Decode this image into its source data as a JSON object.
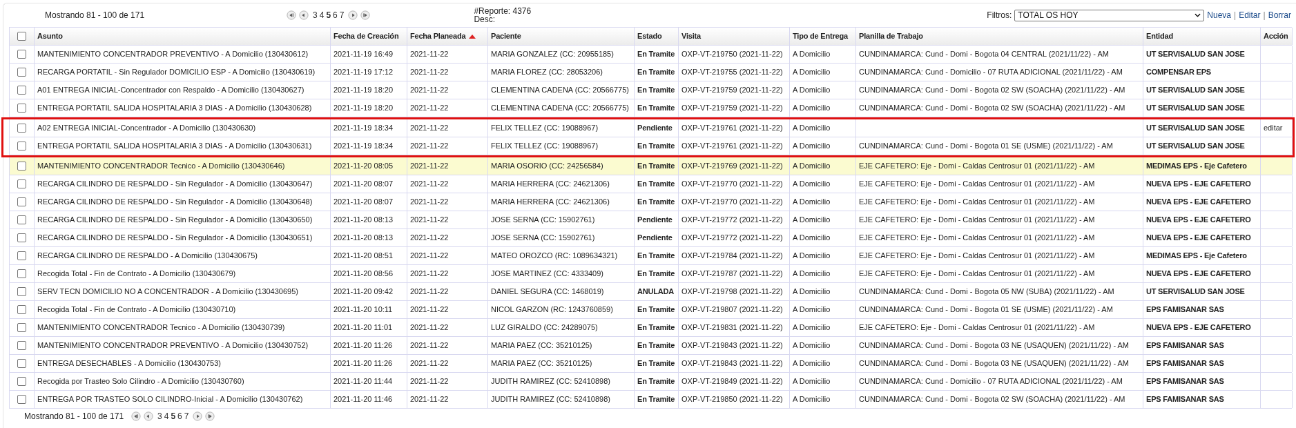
{
  "top_bar": {
    "showing": "Mostrando 81 - 100 de 171",
    "pager": {
      "pages": [
        {
          "label": "3",
          "selected": false
        },
        {
          "label": "4",
          "selected": false
        },
        {
          "label": "5",
          "selected": true
        },
        {
          "label": "6",
          "selected": false
        },
        {
          "label": "7",
          "selected": false
        }
      ]
    },
    "report": "#Reporte: 4376",
    "desc": "Desc:",
    "filter_label": "Filtros:",
    "filter_value": "TOTAL OS HOY",
    "links": [
      "Nueva",
      "Editar",
      "Borrar"
    ],
    "link_separator": "|"
  },
  "table": {
    "select_all": {
      "checked": false
    },
    "columns": [
      {
        "label": "Asunto",
        "sorted": false
      },
      {
        "label": "Fecha de Creación",
        "sorted": false
      },
      {
        "label": "Fecha Planeada",
        "sorted": true
      },
      {
        "label": "Paciente",
        "sorted": false
      },
      {
        "label": "Estado",
        "sorted": false
      },
      {
        "label": "Visita",
        "sorted": false
      },
      {
        "label": "Tipo de Entrega",
        "sorted": false
      },
      {
        "label": "Planilla de Trabajo",
        "sorted": false
      },
      {
        "label": "Entidad",
        "sorted": false
      },
      {
        "label": "Acción",
        "sorted": false
      }
    ],
    "rows": [
      {
        "checked": false,
        "highlighted": false,
        "outlined": false,
        "cells": [
          "MANTENIMIENTO CONCENTRADOR PREVENTIVO - A Domicilio (130430612)",
          "2021-11-19 16:49",
          "2021-11-22",
          "MARIA GONZALEZ (CC: 20955185)",
          "En Tramite",
          "OXP-VT-219750 (2021-11-22)",
          "A Domicilio",
          "CUNDINAMARCA: Cund - Domi - Bogota 04 CENTRAL (2021/11/22) - AM",
          "UT SERVISALUD SAN JOSE",
          ""
        ]
      },
      {
        "checked": false,
        "highlighted": false,
        "outlined": false,
        "cells": [
          "RECARGA PORTATIL - Sin Regulador DOMICILIO ESP - A Domicilio (130430619)",
          "2021-11-19 17:12",
          "2021-11-22",
          "MARIA FLOREZ (CC: 28053206)",
          "En Tramite",
          "OXP-VT-219755 (2021-11-22)",
          "A Domicilio",
          "CUNDINAMARCA: Cund - Domicilio - 07 RUTA ADICIONAL (2021/11/22) - AM",
          "COMPENSAR EPS",
          ""
        ]
      },
      {
        "checked": false,
        "highlighted": false,
        "outlined": false,
        "cells": [
          "A01 ENTREGA INICIAL-Concentrador con Respaldo - A Domicilio (130430627)",
          "2021-11-19 18:20",
          "2021-11-22",
          "CLEMENTINA CADENA (CC: 20566775)",
          "En Tramite",
          "OXP-VT-219759 (2021-11-22)",
          "A Domicilio",
          "CUNDINAMARCA: Cund - Domi - Bogota 02 SW (SOACHA) (2021/11/22) - AM",
          "UT SERVISALUD SAN JOSE",
          ""
        ]
      },
      {
        "checked": false,
        "highlighted": false,
        "outlined": false,
        "cells": [
          "ENTREGA PORTATIL SALIDA HOSPITALARIA 3 DIAS - A Domicilio (130430628)",
          "2021-11-19 18:20",
          "2021-11-22",
          "CLEMENTINA CADENA (CC: 20566775)",
          "En Tramite",
          "OXP-VT-219759 (2021-11-22)",
          "A Domicilio",
          "CUNDINAMARCA: Cund - Domi - Bogota 02 SW (SOACHA) (2021/11/22) - AM",
          "UT SERVISALUD SAN JOSE",
          ""
        ]
      },
      {
        "checked": false,
        "highlighted": false,
        "outlined": true,
        "cells": [
          "A02 ENTREGA INICIAL-Concentrador - A Domicilio (130430630)",
          "2021-11-19 18:34",
          "2021-11-22",
          "FELIX TELLEZ (CC: 19088967)",
          "Pendiente",
          "OXP-VT-219761 (2021-11-22)",
          "A Domicilio",
          "",
          "UT SERVISALUD SAN JOSE",
          "editar"
        ]
      },
      {
        "checked": false,
        "highlighted": false,
        "outlined": true,
        "cells": [
          "ENTREGA PORTATIL SALIDA HOSPITALARIA 3 DIAS - A Domicilio (130430631)",
          "2021-11-19 18:34",
          "2021-11-22",
          "FELIX TELLEZ (CC: 19088967)",
          "En Tramite",
          "OXP-VT-219761 (2021-11-22)",
          "A Domicilio",
          "CUNDINAMARCA: Cund - Domi - Bogota 01 SE (USME) (2021/11/22) - AM",
          "UT SERVISALUD SAN JOSE",
          ""
        ]
      },
      {
        "checked": false,
        "highlighted": true,
        "outlined": false,
        "cells": [
          "MANTENIMIENTO CONCENTRADOR Tecnico - A Domicilio (130430646)",
          "2021-11-20 08:05",
          "2021-11-22",
          "MARIA OSORIO (CC: 24256584)",
          "En Tramite",
          "OXP-VT-219769 (2021-11-22)",
          "A Domicilio",
          "EJE CAFETERO: Eje - Domi - Caldas Centrosur 01 (2021/11/22) - AM",
          "MEDIMAS EPS - Eje Cafetero",
          ""
        ]
      },
      {
        "checked": false,
        "highlighted": false,
        "outlined": false,
        "cells": [
          "RECARGA CILINDRO DE RESPALDO - Sin Regulador - A Domicilio (130430647)",
          "2021-11-20 08:07",
          "2021-11-22",
          "MARIA HERRERA (CC: 24621306)",
          "En Tramite",
          "OXP-VT-219770 (2021-11-22)",
          "A Domicilio",
          "EJE CAFETERO: Eje - Domi - Caldas Centrosur 01 (2021/11/22) - AM",
          "NUEVA EPS - EJE CAFETERO",
          ""
        ]
      },
      {
        "checked": false,
        "highlighted": false,
        "outlined": false,
        "cells": [
          "RECARGA CILINDRO DE RESPALDO - Sin Regulador - A Domicilio (130430648)",
          "2021-11-20 08:07",
          "2021-11-22",
          "MARIA HERRERA (CC: 24621306)",
          "En Tramite",
          "OXP-VT-219770 (2021-11-22)",
          "A Domicilio",
          "EJE CAFETERO: Eje - Domi - Caldas Centrosur 01 (2021/11/22) - AM",
          "NUEVA EPS - EJE CAFETERO",
          ""
        ]
      },
      {
        "checked": false,
        "highlighted": false,
        "outlined": false,
        "cells": [
          "RECARGA CILINDRO DE RESPALDO - Sin Regulador - A Domicilio (130430650)",
          "2021-11-20 08:13",
          "2021-11-22",
          "JOSE SERNA (CC: 15902761)",
          "Pendiente",
          "OXP-VT-219772 (2021-11-22)",
          "A Domicilio",
          "EJE CAFETERO: Eje - Domi - Caldas Centrosur 01 (2021/11/22) - AM",
          "NUEVA EPS - EJE CAFETERO",
          ""
        ]
      },
      {
        "checked": false,
        "highlighted": false,
        "outlined": false,
        "cells": [
          "RECARGA CILINDRO DE RESPALDO - Sin Regulador - A Domicilio (130430651)",
          "2021-11-20 08:13",
          "2021-11-22",
          "JOSE SERNA (CC: 15902761)",
          "Pendiente",
          "OXP-VT-219772 (2021-11-22)",
          "A Domicilio",
          "EJE CAFETERO: Eje - Domi - Caldas Centrosur 01 (2021/11/22) - AM",
          "NUEVA EPS - EJE CAFETERO",
          ""
        ]
      },
      {
        "checked": false,
        "highlighted": false,
        "outlined": false,
        "cells": [
          "RECARGA CILINDRO DE RESPALDO - A Domicilio (130430675)",
          "2021-11-20 08:51",
          "2021-11-22",
          "MATEO OROZCO (RC: 1089634321)",
          "En Tramite",
          "OXP-VT-219784 (2021-11-22)",
          "A Domicilio",
          "EJE CAFETERO: Eje - Domi - Caldas Centrosur 01 (2021/11/22) - AM",
          "MEDIMAS EPS - Eje Cafetero",
          ""
        ]
      },
      {
        "checked": false,
        "highlighted": false,
        "outlined": false,
        "cells": [
          "Recogida Total - Fin de Contrato - A Domicilio (130430679)",
          "2021-11-20 08:56",
          "2021-11-22",
          "JOSE MARTINEZ (CC: 4333409)",
          "En Tramite",
          "OXP-VT-219787 (2021-11-22)",
          "A Domicilio",
          "EJE CAFETERO: Eje - Domi - Caldas Centrosur 01 (2021/11/22) - AM",
          "NUEVA EPS - EJE CAFETERO",
          ""
        ]
      },
      {
        "checked": false,
        "highlighted": false,
        "outlined": false,
        "cells": [
          "SERV TECN DOMICILIO NO A CONCENTRADOR - A Domicilio (130430695)",
          "2021-11-20 09:42",
          "2021-11-22",
          "DANIEL SEGURA (CC: 1468019)",
          "ANULADA",
          "OXP-VT-219798 (2021-11-22)",
          "A Domicilio",
          "CUNDINAMARCA: Cund - Domi - Bogota 05 NW (SUBA) (2021/11/22) - AM",
          "UT SERVISALUD SAN JOSE",
          ""
        ]
      },
      {
        "checked": false,
        "highlighted": false,
        "outlined": false,
        "cells": [
          "Recogida Total - Fin de Contrato - A Domicilio (130430710)",
          "2021-11-20 10:11",
          "2021-11-22",
          "NICOL GARZON (RC: 1243760859)",
          "En Tramite",
          "OXP-VT-219807 (2021-11-22)",
          "A Domicilio",
          "CUNDINAMARCA: Cund - Domi - Bogota 01 SE (USME) (2021/11/22) - AM",
          "EPS FAMISANAR SAS",
          ""
        ]
      },
      {
        "checked": false,
        "highlighted": false,
        "outlined": false,
        "cells": [
          "MANTENIMIENTO CONCENTRADOR Tecnico - A Domicilio (130430739)",
          "2021-11-20 11:01",
          "2021-11-22",
          "LUZ GIRALDO (CC: 24289075)",
          "En Tramite",
          "OXP-VT-219831 (2021-11-22)",
          "A Domicilio",
          "EJE CAFETERO: Eje - Domi - Caldas Centrosur 01 (2021/11/22) - AM",
          "NUEVA EPS - EJE CAFETERO",
          ""
        ]
      },
      {
        "checked": false,
        "highlighted": false,
        "outlined": false,
        "cells": [
          "MANTENIMIENTO CONCENTRADOR PREVENTIVO - A Domicilio (130430752)",
          "2021-11-20 11:26",
          "2021-11-22",
          "MARIA PAEZ (CC: 35210125)",
          "En Tramite",
          "OXP-VT-219843 (2021-11-22)",
          "A Domicilio",
          "CUNDINAMARCA: Cund - Domi - Bogota 03 NE (USAQUEN) (2021/11/22) - AM",
          "EPS FAMISANAR SAS",
          ""
        ]
      },
      {
        "checked": false,
        "highlighted": false,
        "outlined": false,
        "cells": [
          "ENTREGA DESECHABLES - A Domicilio (130430753)",
          "2021-11-20 11:26",
          "2021-11-22",
          "MARIA PAEZ (CC: 35210125)",
          "En Tramite",
          "OXP-VT-219843 (2021-11-22)",
          "A Domicilio",
          "CUNDINAMARCA: Cund - Domi - Bogota 03 NE (USAQUEN) (2021/11/22) - AM",
          "EPS FAMISANAR SAS",
          ""
        ]
      },
      {
        "checked": false,
        "highlighted": false,
        "outlined": false,
        "cells": [
          "Recogida por Trasteo Solo Cilindro - A Domicilio (130430760)",
          "2021-11-20 11:44",
          "2021-11-22",
          "JUDITH RAMIREZ (CC: 52410898)",
          "En Tramite",
          "OXP-VT-219849 (2021-11-22)",
          "A Domicilio",
          "CUNDINAMARCA: Cund - Domicilio - 07 RUTA ADICIONAL (2021/11/22) - AM",
          "EPS FAMISANAR SAS",
          ""
        ]
      },
      {
        "checked": false,
        "highlighted": false,
        "outlined": false,
        "cells": [
          "ENTREGA POR TRASTEO SOLO CILINDRO-Inicial - A Domicilio (130430762)",
          "2021-11-20 11:46",
          "2021-11-22",
          "JUDITH RAMIREZ (CC: 52410898)",
          "En Tramite",
          "OXP-VT-219850 (2021-11-22)",
          "A Domicilio",
          "CUNDINAMARCA: Cund - Domi - Bogota 02 SW (SOACHA) (2021/11/22) - AM",
          "EPS FAMISANAR SAS",
          ""
        ]
      }
    ]
  },
  "bottom_bar": {
    "showing": "Mostrando 81 - 100 de 171",
    "pager": {
      "pages": [
        {
          "label": "3",
          "selected": false
        },
        {
          "label": "4",
          "selected": false
        },
        {
          "label": "5",
          "selected": true
        },
        {
          "label": "6",
          "selected": false
        },
        {
          "label": "7",
          "selected": false
        }
      ]
    }
  }
}
